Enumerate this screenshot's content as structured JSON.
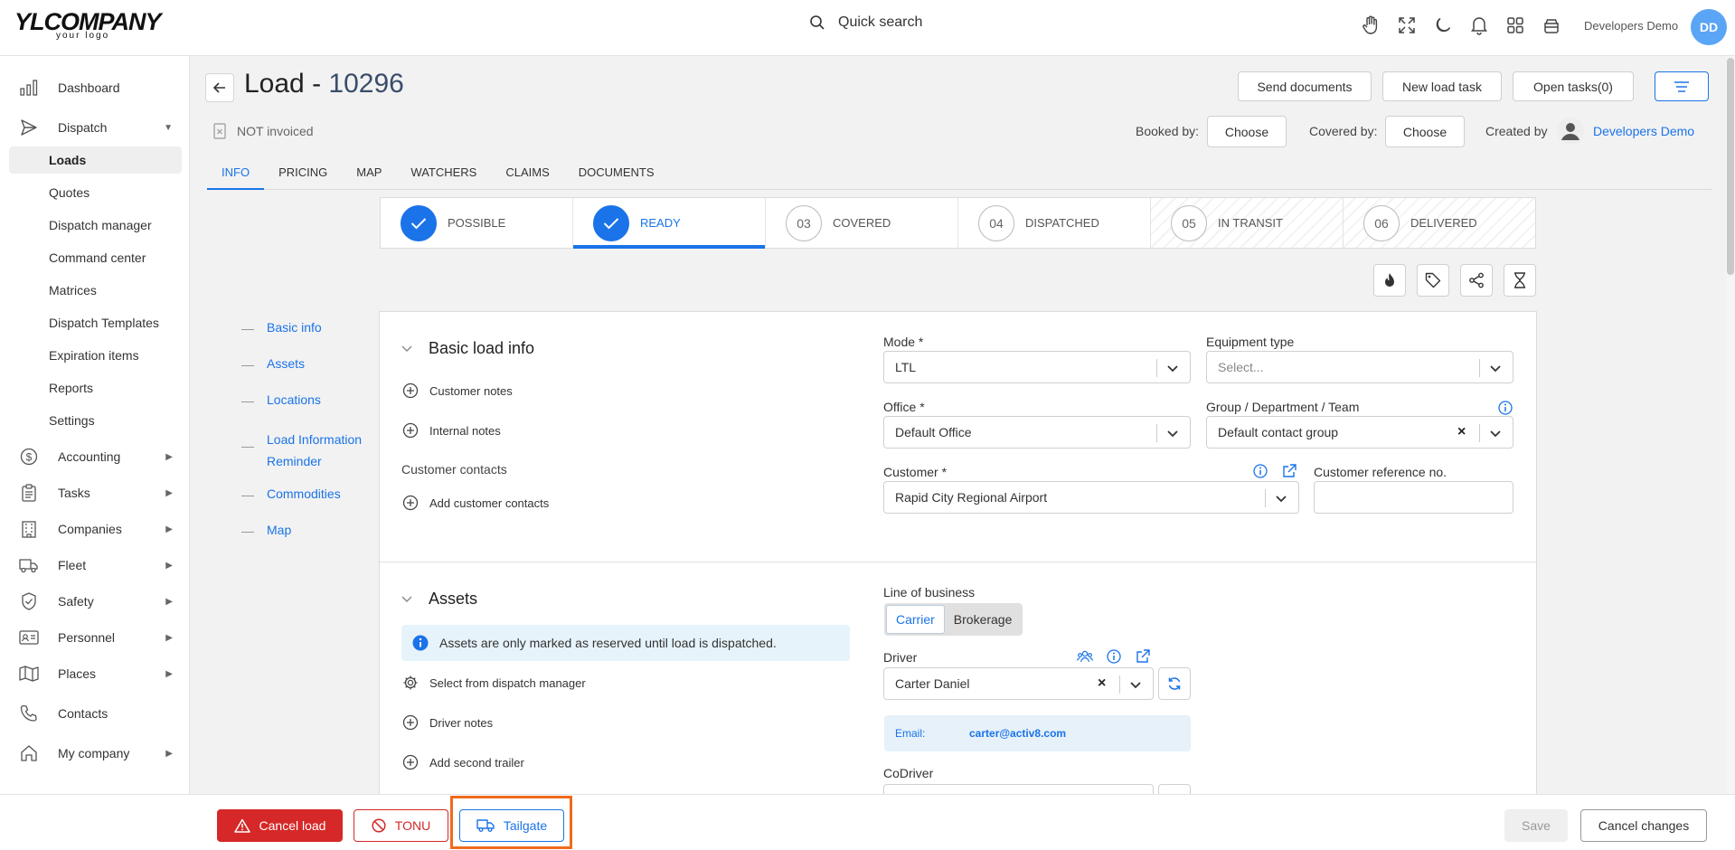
{
  "header": {
    "logo_line1": "YLCOMPANY",
    "logo_line2": "your logo",
    "search_label": "Quick search",
    "user_name": "Developers Demo",
    "user_initials": "DD",
    "icons": [
      "hand-icon",
      "fullscreen-icon",
      "moon-icon",
      "bell-icon",
      "apps-grid-icon",
      "archive-icon"
    ]
  },
  "sidebar": {
    "items": [
      {
        "label": "Dashboard",
        "icon": "bar-chart-icon"
      },
      {
        "label": "Dispatch",
        "icon": "send-icon",
        "expanded": true
      },
      {
        "label": "Accounting",
        "icon": "dollar-icon"
      },
      {
        "label": "Tasks",
        "icon": "clipboard-icon"
      },
      {
        "label": "Companies",
        "icon": "building-icon"
      },
      {
        "label": "Fleet",
        "icon": "truck-icon"
      },
      {
        "label": "Safety",
        "icon": "shield-icon"
      },
      {
        "label": "Personnel",
        "icon": "id-card-icon"
      },
      {
        "label": "Places",
        "icon": "map-icon"
      },
      {
        "label": "Contacts",
        "icon": "phone-icon"
      },
      {
        "label": "My company",
        "icon": "home-icon"
      }
    ],
    "dispatch_sub": [
      "Loads",
      "Quotes",
      "Dispatch manager",
      "Command center",
      "Matrices",
      "Dispatch Templates",
      "Expiration items",
      "Reports",
      "Settings"
    ],
    "active_sub": "Loads"
  },
  "page": {
    "title_prefix": "Load - ",
    "load_number": "10296",
    "invoice_status": "NOT invoiced",
    "buttons": {
      "send_documents": "Send documents",
      "new_load_task": "New load task",
      "open_tasks": "Open tasks(0)"
    },
    "booked_by_label": "Booked by:",
    "covered_by_label": "Covered by:",
    "choose": "Choose",
    "created_by_label": "Created by",
    "created_by_name": "Developers Demo"
  },
  "tabs": [
    "INFO",
    "PRICING",
    "MAP",
    "WATCHERS",
    "CLAIMS",
    "DOCUMENTS"
  ],
  "active_tab": "INFO",
  "stepper": [
    {
      "num": "",
      "label": "POSSIBLE",
      "state": "done"
    },
    {
      "num": "",
      "label": "READY",
      "state": "current"
    },
    {
      "num": "03",
      "label": "COVERED",
      "state": "pending"
    },
    {
      "num": "04",
      "label": "DISPATCHED",
      "state": "pending"
    },
    {
      "num": "05",
      "label": "IN TRANSIT",
      "state": "disabled"
    },
    {
      "num": "06",
      "label": "DELIVERED",
      "state": "disabled"
    }
  ],
  "action_icons": [
    "flame-icon",
    "tag-icon",
    "share-icon",
    "hourglass-icon"
  ],
  "anchors": [
    "Basic info",
    "Assets",
    "Locations",
    "Load Information Reminder",
    "Commodities",
    "Map"
  ],
  "basic_info": {
    "title": "Basic load info",
    "customer_notes": "Customer notes",
    "internal_notes": "Internal notes",
    "customer_contacts": "Customer contacts",
    "add_customer_contacts": "Add customer contacts",
    "mode_label": "Mode *",
    "mode_value": "LTL",
    "equipment_label": "Equipment type",
    "equipment_placeholder": "Select...",
    "office_label": "Office *",
    "office_value": "Default Office",
    "group_label": "Group / Department / Team",
    "group_value": "Default contact group",
    "customer_label": "Customer *",
    "customer_value": "Rapid City Regional Airport",
    "customer_ref_label": "Customer reference no.",
    "customer_ref_value": ""
  },
  "assets": {
    "title": "Assets",
    "info_text": "Assets are only marked as reserved until load is dispatched.",
    "select_dispatch_manager": "Select from dispatch manager",
    "driver_notes": "Driver notes",
    "add_second_trailer": "Add second trailer",
    "line_of_business_label": "Line of business",
    "lob_options": [
      "Carrier",
      "Brokerage"
    ],
    "lob_selected": "Carrier",
    "driver_label": "Driver",
    "driver_value": "Carter Daniel",
    "email_label": "Email:",
    "email_value": "carter@activ8.com",
    "codriver_label": "CoDriver"
  },
  "bottom": {
    "cancel_load": "Cancel load",
    "tonu": "TONU",
    "tailgate": "Tailgate",
    "save": "Save",
    "cancel_changes": "Cancel changes"
  },
  "colors": {
    "accent": "#1a73e8",
    "danger": "#d62828",
    "highlight": "#f06a1d"
  }
}
